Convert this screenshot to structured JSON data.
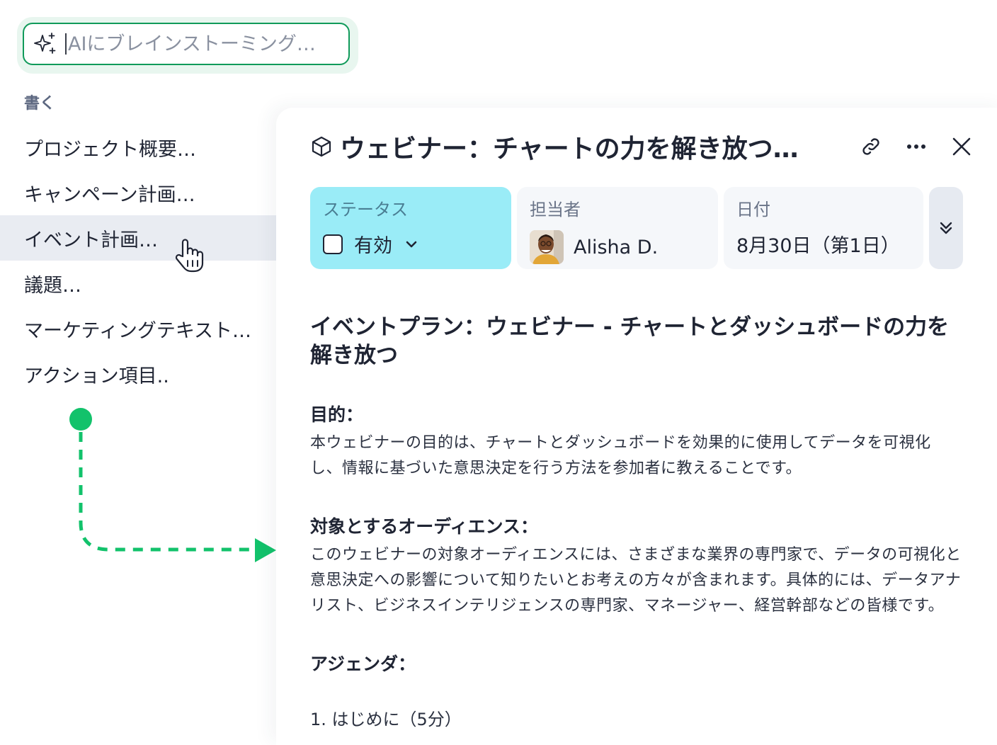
{
  "ai_search": {
    "placeholder": "AIにブレインストーミング…",
    "value": ""
  },
  "menu": {
    "heading": "書く",
    "items": [
      {
        "label": "プロジェクト概要…"
      },
      {
        "label": "キャンペーン計画…"
      },
      {
        "label": "イベント計画…"
      },
      {
        "label": "議題…"
      },
      {
        "label": "マーケティングテキスト…"
      },
      {
        "label": "アクション項目.."
      }
    ]
  },
  "colors": {
    "accent_green": "#12c26b",
    "status_bg": "#9aecf7"
  },
  "panel": {
    "title": "ウェビナー：チャートの力を解き放つ…",
    "fields": {
      "status": {
        "label": "ステータス",
        "value": "有効",
        "checked": false
      },
      "assignee": {
        "label": "担当者",
        "value": "Alisha D."
      },
      "date": {
        "label": "日付",
        "value": "8月30日（第1日）"
      }
    },
    "doc": {
      "title": "イベントプラン：ウェビナー - チャートとダッシュボードの力を解き放つ",
      "sections": [
        {
          "heading": "目的：",
          "body": "本ウェビナーの目的は、チャートとダッシュボードを効果的に使用してデータを可視化し、情報に基づいた意思決定を行う方法を参加者に教えることです。"
        },
        {
          "heading": "対象とするオーディエンス：",
          "body": "このウェビナーの対象オーディエンスには、さまざまな業界の専門家で、データの可視化と意思決定への影響について知りたいとお考えの方々が含まれます。具体的には、データアナリスト、ビジネスインテリジェンスの専門家、マネージャー、経営幹部などの皆様です。"
        },
        {
          "heading": "アジェンダ："
        }
      ],
      "agenda_first": "1. はじめに（5分）"
    }
  }
}
